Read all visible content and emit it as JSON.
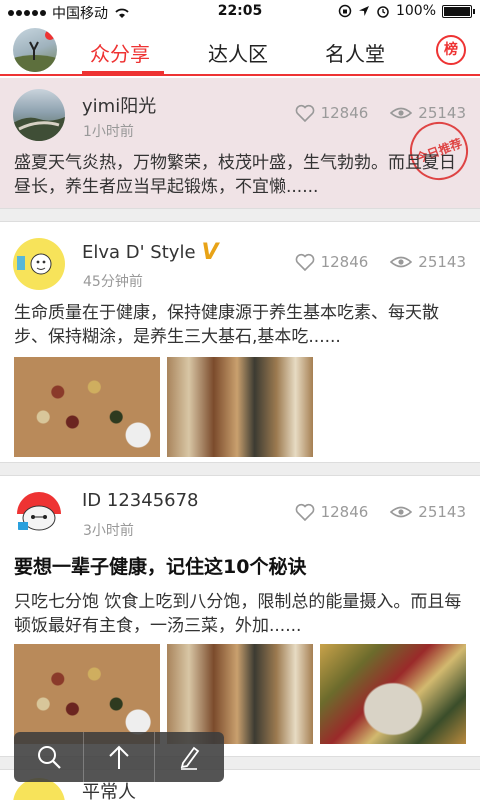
{
  "status_bar": {
    "carrier": "中国移动",
    "time": "22:05",
    "battery": "100%"
  },
  "nav": {
    "tabs": [
      "众分享",
      "达人区",
      "名人堂"
    ],
    "active_tab": "众分享",
    "rank_label": "榜"
  },
  "posts": [
    {
      "name": "yimi阳光",
      "time": "1小时前",
      "likes": "12846",
      "views": "25143",
      "badge": "今日推荐",
      "text": "盛夏天气炎热，万物繁荣，枝茂叶盛，生气勃勃。而且夏日昼长，养生者应当早起锻炼，不宜懒......"
    },
    {
      "name": "Elva D' Style",
      "time": "45分钟前",
      "likes": "12846",
      "views": "25143",
      "verified_mark": "V",
      "text": "生命质量在于健康，保持健康源于养生基本吃素、每天散步、保持糊涂，是养生三大基石,基本吃......"
    },
    {
      "name": "ID 12345678",
      "time": "3小时前",
      "likes": "12846",
      "views": "25143",
      "title": "要想一辈子健康，记住这10个秘诀",
      "text": "只吃七分饱 饮食上吃到八分饱，限制总的能量摄入。而且每顿饭最好有主食，一汤三菜，外加......"
    },
    {
      "name": "平常人"
    }
  ],
  "colors": {
    "accent": "#ee3333",
    "featured_bg": "#f0e3e6"
  },
  "toolbar": [
    "search-icon",
    "arrow-up-icon",
    "pencil-icon"
  ]
}
